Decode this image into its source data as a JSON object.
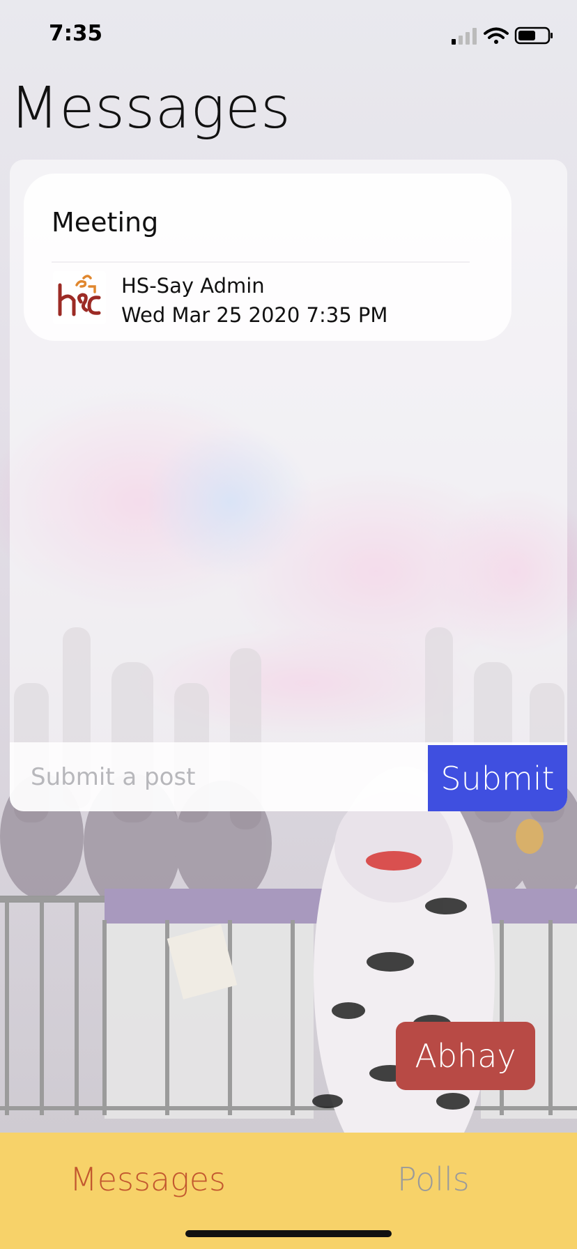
{
  "status_bar": {
    "time": "7:35",
    "icons": [
      "signal-icon",
      "wifi-icon",
      "battery-icon"
    ]
  },
  "header": {
    "title": "Messages"
  },
  "messages": [
    {
      "title": "Meeting",
      "author": "HS-Say Admin",
      "date": "Wed Mar 25 2020 7:35 PM",
      "avatar_icon": "hsc-logo-icon"
    }
  ],
  "composer": {
    "placeholder": "Submit a post",
    "submit_label": "Submit"
  },
  "user_button": {
    "label": "Abhay"
  },
  "tabs": [
    {
      "label": "Messages",
      "active": true
    },
    {
      "label": "Polls",
      "active": false
    }
  ],
  "colors": {
    "submit": "#3f4fe0",
    "user_button": "#b84a45",
    "tab_bar": "#f7d269",
    "tab_active": "#c2572f",
    "tab_inactive": "#9a9a9a"
  }
}
